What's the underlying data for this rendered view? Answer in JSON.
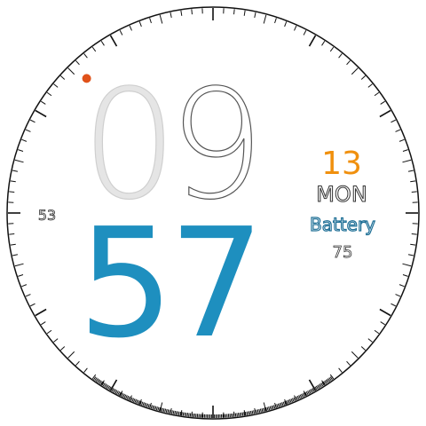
{
  "watch": {
    "hour": "09",
    "minute": "57",
    "seconds_side": "53",
    "date_day": "13",
    "weekday": "MON",
    "battery_label": "Battery",
    "battery_value": "75",
    "seconds_progress": 0.88
  },
  "colors": {
    "hour_fill": "#e5e5e5",
    "hour_outline": "#cfcfcf",
    "minute": "#1e8fbf",
    "day": "#f0900e",
    "weekday": "#ffffff",
    "battery_label": "#1e6f96",
    "battery_value": "#ffffff",
    "ticks": "#111111",
    "second_marker": "#e0521a"
  }
}
